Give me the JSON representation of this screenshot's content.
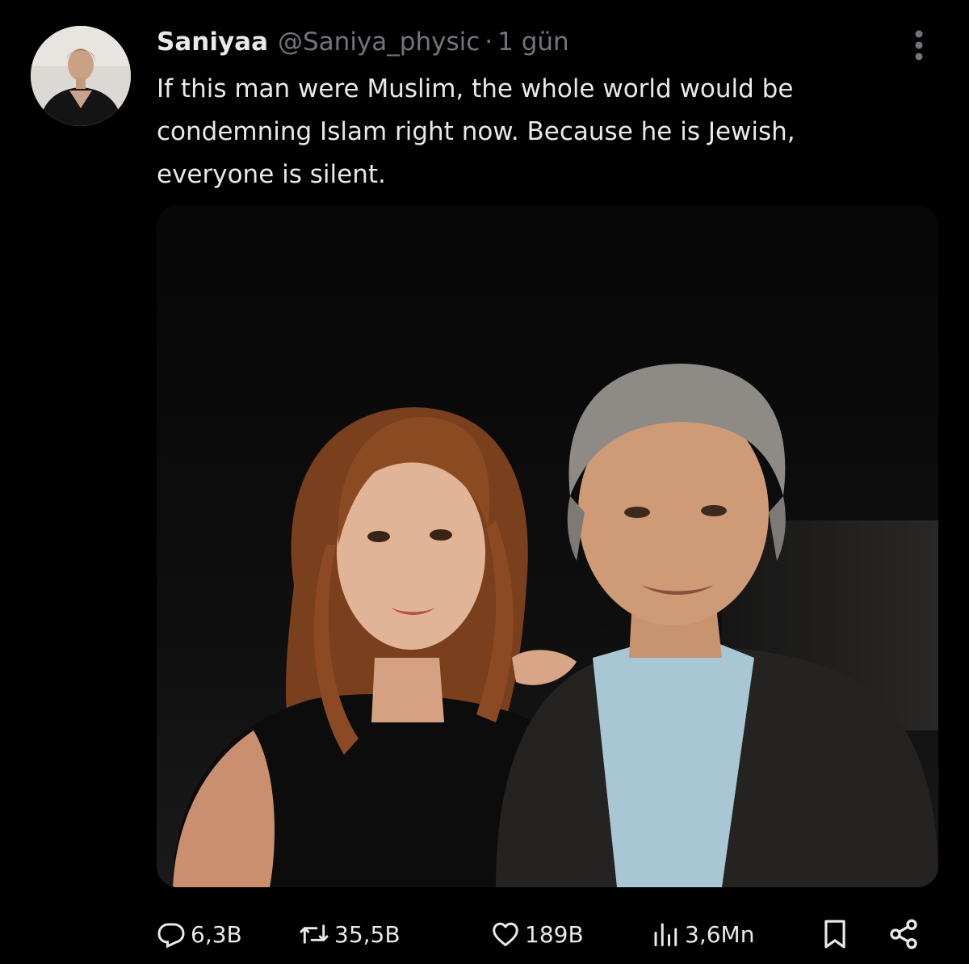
{
  "tweet": {
    "author_name": "Saniyaa",
    "handle": "@Saniya_physic",
    "separator": "·",
    "time": "1 gün",
    "text": "If this man were Muslim, the whole world would be condemning Islam right now. Because he is Jewish, everyone is silent.",
    "avatar_icon": "user-avatar-icon",
    "media": {
      "description": "Photo of a woman with long auburn hair and a gray-haired man in a dark jacket and light blue shirt against a dark background"
    },
    "actions": {
      "replies": "6,3B",
      "retweets": "35,5B",
      "likes": "189B",
      "views": "3,6Mn"
    }
  },
  "colors": {
    "background": "#000000",
    "text": "#e7e9ea",
    "secondary": "#71767b"
  },
  "icons": [
    "more-icon",
    "reply-icon",
    "retweet-icon",
    "like-icon",
    "views-icon",
    "bookmark-icon",
    "share-icon"
  ]
}
